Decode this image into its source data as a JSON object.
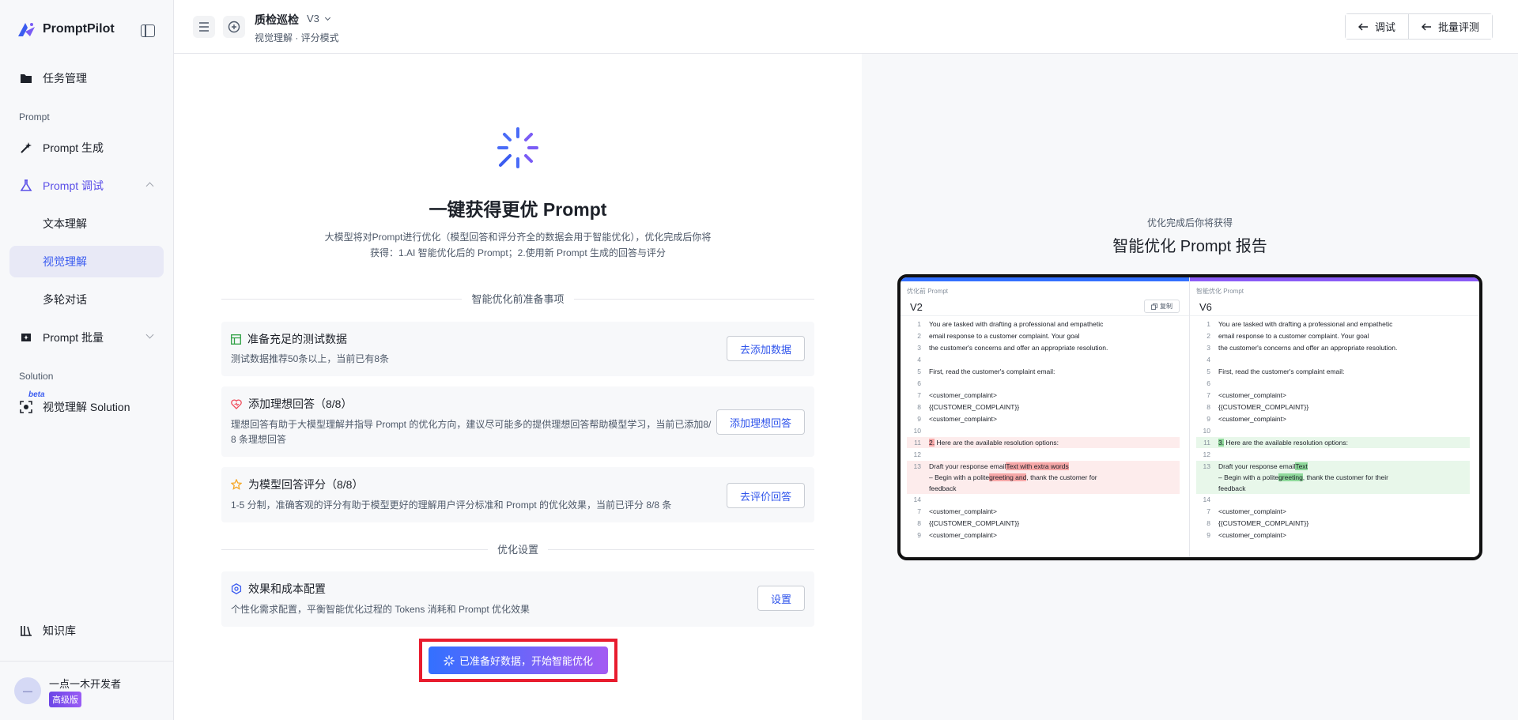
{
  "sidebar": {
    "brand": "PromptPilot",
    "task_management": "任务管理",
    "section_prompt": "Prompt",
    "prompt_generate": "Prompt 生成",
    "prompt_debug": "Prompt 调试",
    "text_understanding": "文本理解",
    "visual_understanding": "视觉理解",
    "multi_turn": "多轮对话",
    "prompt_batch": "Prompt 批量",
    "section_solution": "Solution",
    "beta": "beta",
    "visual_solution": "视觉理解 Solution",
    "knowledge_base": "知识库",
    "user_name": "一点一木开发者",
    "user_badge": "高级版"
  },
  "topbar": {
    "title": "质检巡检",
    "version": "V3",
    "subtitle": "视觉理解 · 评分模式",
    "debug_btn": "调试",
    "batch_btn": "批量评测"
  },
  "hero": {
    "title": "一键获得更优 Prompt",
    "desc": "大模型将对Prompt进行优化（模型回答和评分齐全的数据会用于智能优化），优化完成后你将获得：1.AI 智能优化后的 Prompt；2.使用新 Prompt 生成的回答与评分"
  },
  "prep_section": "智能优化前准备事项",
  "cards": [
    {
      "title": "准备充足的测试数据",
      "desc": "测试数据推荐50条以上，当前已有8条",
      "button": "去添加数据"
    },
    {
      "title": "添加理想回答（8/8）",
      "desc_line1": "理想回答有助于大模型理解并指导 Prompt 的优化方向，建议尽可能多的提供理想回答帮助模型学习，当前已添加8/",
      "desc_line2": "8 条理想回答",
      "button": "添加理想回答"
    },
    {
      "title": "为模型回答评分（8/8）",
      "desc": "1-5 分制，准确客观的评分有助于模型更好的理解用户评分标准和 Prompt 的优化效果，当前已评分 8/8 条",
      "button": "去评价回答"
    }
  ],
  "settings_section": "优化设置",
  "settings_card": {
    "title": "效果和成本配置",
    "desc": "个性化需求配置，平衡智能优化过程的 Tokens 消耗和 Prompt 优化效果",
    "button": "设置"
  },
  "cta": "已准备好数据，开始智能优化",
  "preview": {
    "eyebrow": "优化完成后你将获得",
    "title": "智能优化 Prompt 报告",
    "left_head": "优化前 Prompt",
    "left_version": "V2",
    "copy": "复制",
    "right_head": "智能优化 Prompt",
    "right_version": "V6",
    "lines_left": [
      {
        "n": "1",
        "t": "You are tasked with drafting a professional and empathetic"
      },
      {
        "n": "2",
        "t": "email response to a customer complaint. Your goal"
      },
      {
        "n": "3",
        "t": "the customer's concerns and offer an appropriate resolution."
      },
      {
        "n": "4",
        "t": ""
      },
      {
        "n": "5",
        "t": "First, read the customer's complaint email:"
      },
      {
        "n": "6",
        "t": ""
      },
      {
        "n": "7",
        "t": "<customer_complaint>"
      },
      {
        "n": "8",
        "t": "{{CUSTOMER_COMPLAINT}}"
      },
      {
        "n": "9",
        "t": "<customer_complaint>"
      },
      {
        "n": "10",
        "t": ""
      },
      {
        "n": "11",
        "mark": "2.",
        "t": " Here are the available resolution options:"
      },
      {
        "n": "12",
        "t": ""
      },
      {
        "n": "13",
        "pre": "Draft your response email",
        "mark": "Text with extra words",
        "post": ""
      },
      {
        "n": "",
        "pre": "– Begin with a polite",
        "mark": "greeting and",
        "post": ", thank the customer for"
      },
      {
        "n": "",
        "t": "feedback"
      },
      {
        "n": "14",
        "t": ""
      },
      {
        "n": "7",
        "t": "<customer_complaint>"
      },
      {
        "n": "8",
        "t": "{{CUSTOMER_COMPLAINT}}"
      },
      {
        "n": "9",
        "t": "<customer_complaint>"
      }
    ],
    "lines_right": [
      {
        "n": "1",
        "t": "You are tasked with drafting a professional and empathetic"
      },
      {
        "n": "2",
        "t": "email response to a customer complaint. Your goal"
      },
      {
        "n": "3",
        "t": "the customer's concerns and offer an appropriate resolution."
      },
      {
        "n": "4",
        "t": ""
      },
      {
        "n": "5",
        "t": "First, read the customer's complaint email:"
      },
      {
        "n": "6",
        "t": ""
      },
      {
        "n": "7",
        "t": "<customer_complaint>"
      },
      {
        "n": "8",
        "t": "{{CUSTOMER_COMPLAINT}}"
      },
      {
        "n": "9",
        "t": "<customer_complaint>"
      },
      {
        "n": "10",
        "t": ""
      },
      {
        "n": "11",
        "mark": "3.",
        "t": " Here are the available resolution options:"
      },
      {
        "n": "12",
        "t": ""
      },
      {
        "n": "13",
        "pre": "Draft your response email",
        "mark": "Text",
        "post": ""
      },
      {
        "n": "",
        "pre": "– Begin with a polite",
        "mark": "greeting",
        "post": ", thank the customer for their"
      },
      {
        "n": "",
        "t": "feedback"
      },
      {
        "n": "14",
        "t": ""
      },
      {
        "n": "7",
        "t": "<customer_complaint>"
      },
      {
        "n": "8",
        "t": "{{CUSTOMER_COMPLAINT}}"
      },
      {
        "n": "9",
        "t": "<customer_complaint>"
      }
    ]
  },
  "colors": {
    "accent": "#3370ff",
    "accent_purple": "#a35bf3",
    "highlight_red": "#e81c2e"
  }
}
